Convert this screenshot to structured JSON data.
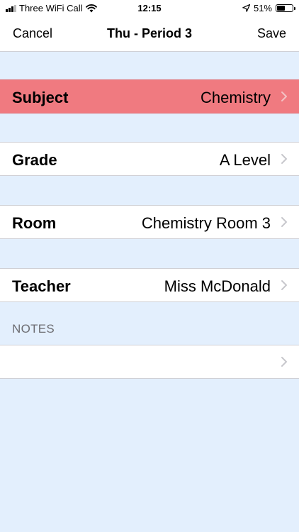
{
  "status_bar": {
    "carrier": "Three WiFi Call",
    "time": "12:15",
    "battery": "51%",
    "battery_level": 0.51
  },
  "nav": {
    "left": "Cancel",
    "title": "Thu - Period 3",
    "right": "Save"
  },
  "rows": [
    {
      "label": "Subject",
      "value": "Chemistry"
    },
    {
      "label": "Grade",
      "value": "A Level"
    },
    {
      "label": "Room",
      "value": "Chemistry Room 3"
    },
    {
      "label": "Teacher",
      "value": "Miss McDonald"
    }
  ],
  "notes": {
    "header": "NOTES",
    "value": ""
  },
  "colors": {
    "background": "#e3effd",
    "highlight": "#f07a80"
  }
}
